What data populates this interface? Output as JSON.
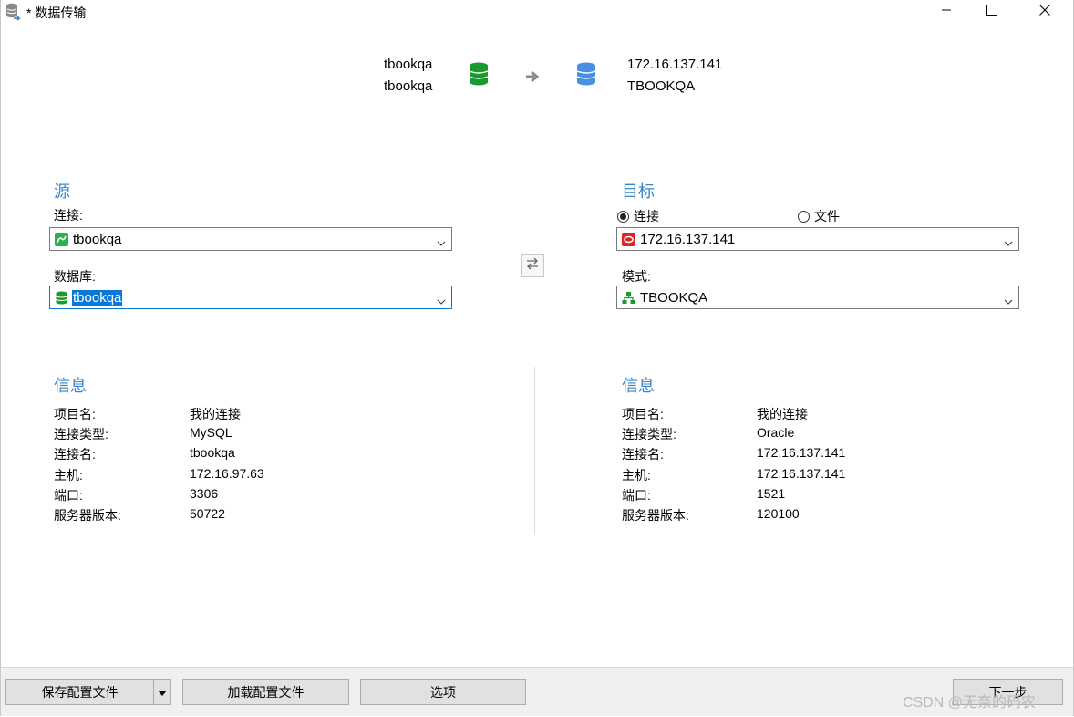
{
  "window": {
    "title": "* 数据传输",
    "icons": {
      "app": "database-transfer-icon",
      "minimize": "minimize-icon",
      "maximize": "maximize-icon",
      "close": "close-icon"
    }
  },
  "header": {
    "source_connection": "tbookqa",
    "source_database": "tbookqa",
    "target_connection": "172.16.137.141",
    "target_schema": "TBOOKQA",
    "source_color": "#1a9a2e",
    "target_color": "#4a90e2"
  },
  "source": {
    "title": "源",
    "connection_label": "连接:",
    "connection_value": "tbookqa",
    "database_label": "数据库:",
    "database_value": "tbookqa"
  },
  "target": {
    "title": "目标",
    "radio_connection": "连接",
    "radio_file": "文件",
    "selected": "connection",
    "connection_value": "172.16.137.141",
    "schema_label": "模式:",
    "schema_value": "TBOOKQA"
  },
  "source_info": {
    "title": "信息",
    "rows": [
      {
        "label": "项目名:",
        "value": "我的连接"
      },
      {
        "label": "连接类型:",
        "value": "MySQL"
      },
      {
        "label": "连接名:",
        "value": "tbookqa"
      },
      {
        "label": "主机:",
        "value": "172.16.97.63"
      },
      {
        "label": "端口:",
        "value": "3306"
      },
      {
        "label": "服务器版本:",
        "value": "50722"
      }
    ]
  },
  "target_info": {
    "title": "信息",
    "rows": [
      {
        "label": "项目名:",
        "value": "我的连接"
      },
      {
        "label": "连接类型:",
        "value": "Oracle"
      },
      {
        "label": "连接名:",
        "value": "172.16.137.141"
      },
      {
        "label": "主机:",
        "value": "172.16.137.141"
      },
      {
        "label": "端口:",
        "value": "1521"
      },
      {
        "label": "服务器版本:",
        "value": "120100"
      }
    ]
  },
  "footer": {
    "save_profile": "保存配置文件",
    "load_profile": "加载配置文件",
    "options": "选项",
    "next": "下一步"
  },
  "watermark": "CSDN @无奈的码农",
  "accent_color": "#3b86c9"
}
